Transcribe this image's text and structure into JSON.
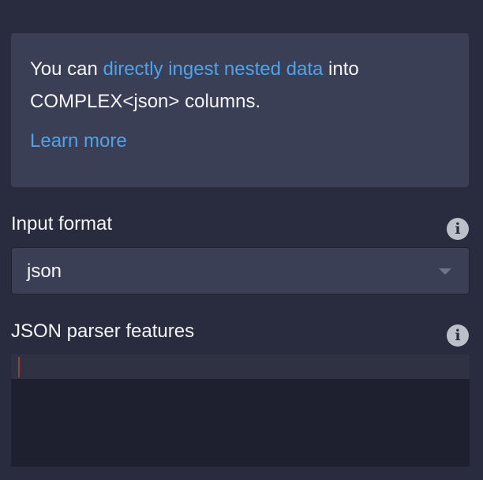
{
  "callout": {
    "text_before": "You can ",
    "link_text": "directly ingest nested data",
    "text_after": " into COMPLEX<json> columns.",
    "learn_more": "Learn more"
  },
  "input_format": {
    "label": "Input format",
    "value": "json",
    "info_icon": "i"
  },
  "json_parser_features": {
    "label": "JSON parser features",
    "info_icon": "i",
    "value": ""
  },
  "colors": {
    "background": "#282c3e",
    "panel": "#3b3f55",
    "link": "#4ea3ea",
    "editor_background": "#1e2030"
  }
}
